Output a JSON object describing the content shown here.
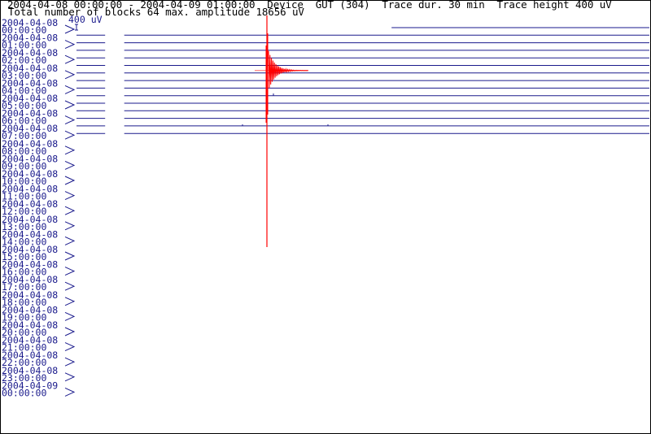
{
  "header": {
    "line1": "2004-04-08 00:00:00 - 2004-04-09 01:00:00  Device  GUT (304)  Trace dur. 30 min  Trace height 400 uV",
    "line2": "Total number of blocks 64 max. amplitude 18656 uV"
  },
  "scale": {
    "label": "400 uV"
  },
  "colors": {
    "text": "#1a1a8c",
    "trace": "#1a1a8c",
    "event": "#ff0000",
    "background": "#ffffff"
  },
  "chart_data": {
    "type": "line",
    "rows": [
      {
        "date": "2004-04-08",
        "time": "00:00:00"
      },
      {
        "date": "2004-04-08",
        "time": "01:00:00"
      },
      {
        "date": "2004-04-08",
        "time": "02:00:00"
      },
      {
        "date": "2004-04-08",
        "time": "03:00:00"
      },
      {
        "date": "2004-04-08",
        "time": "04:00:00"
      },
      {
        "date": "2004-04-08",
        "time": "05:00:00"
      },
      {
        "date": "2004-04-08",
        "time": "06:00:00"
      },
      {
        "date": "2004-04-08",
        "time": "07:00:00"
      },
      {
        "date": "2004-04-08",
        "time": "08:00:00"
      },
      {
        "date": "2004-04-08",
        "time": "09:00:00"
      },
      {
        "date": "2004-04-08",
        "time": "10:00:00"
      },
      {
        "date": "2004-04-08",
        "time": "11:00:00"
      },
      {
        "date": "2004-04-08",
        "time": "12:00:00"
      },
      {
        "date": "2004-04-08",
        "time": "13:00:00"
      },
      {
        "date": "2004-04-08",
        "time": "14:00:00"
      },
      {
        "date": "2004-04-08",
        "time": "15:00:00"
      },
      {
        "date": "2004-04-08",
        "time": "16:00:00"
      },
      {
        "date": "2004-04-08",
        "time": "17:00:00"
      },
      {
        "date": "2004-04-08",
        "time": "18:00:00"
      },
      {
        "date": "2004-04-08",
        "time": "19:00:00"
      },
      {
        "date": "2004-04-08",
        "time": "20:00:00"
      },
      {
        "date": "2004-04-08",
        "time": "21:00:00"
      },
      {
        "date": "2004-04-08",
        "time": "22:00:00"
      },
      {
        "date": "2004-04-08",
        "time": "23:00:00"
      },
      {
        "date": "2004-04-09",
        "time": "00:00:00"
      }
    ],
    "traces_per_row": 2,
    "recorded_until_minute_of_day": 450,
    "event_minute_of_day": 190,
    "event_peak_amplitude_uv": 18656,
    "trace_height_uv": 400,
    "gap_minutes_at_trace_start": [
      [
        0,
        165
      ],
      [
        15,
        25
      ],
      [
        15,
        25
      ],
      [
        15,
        25
      ],
      [
        15,
        25
      ],
      [
        15,
        25
      ],
      [
        15,
        25
      ],
      [
        15,
        25
      ],
      [
        15,
        25
      ],
      [
        15,
        25
      ],
      [
        15,
        25
      ],
      [
        15,
        25
      ],
      [
        15,
        25
      ],
      [
        15,
        25
      ],
      [
        15,
        25
      ],
      [
        15,
        25
      ]
    ]
  }
}
